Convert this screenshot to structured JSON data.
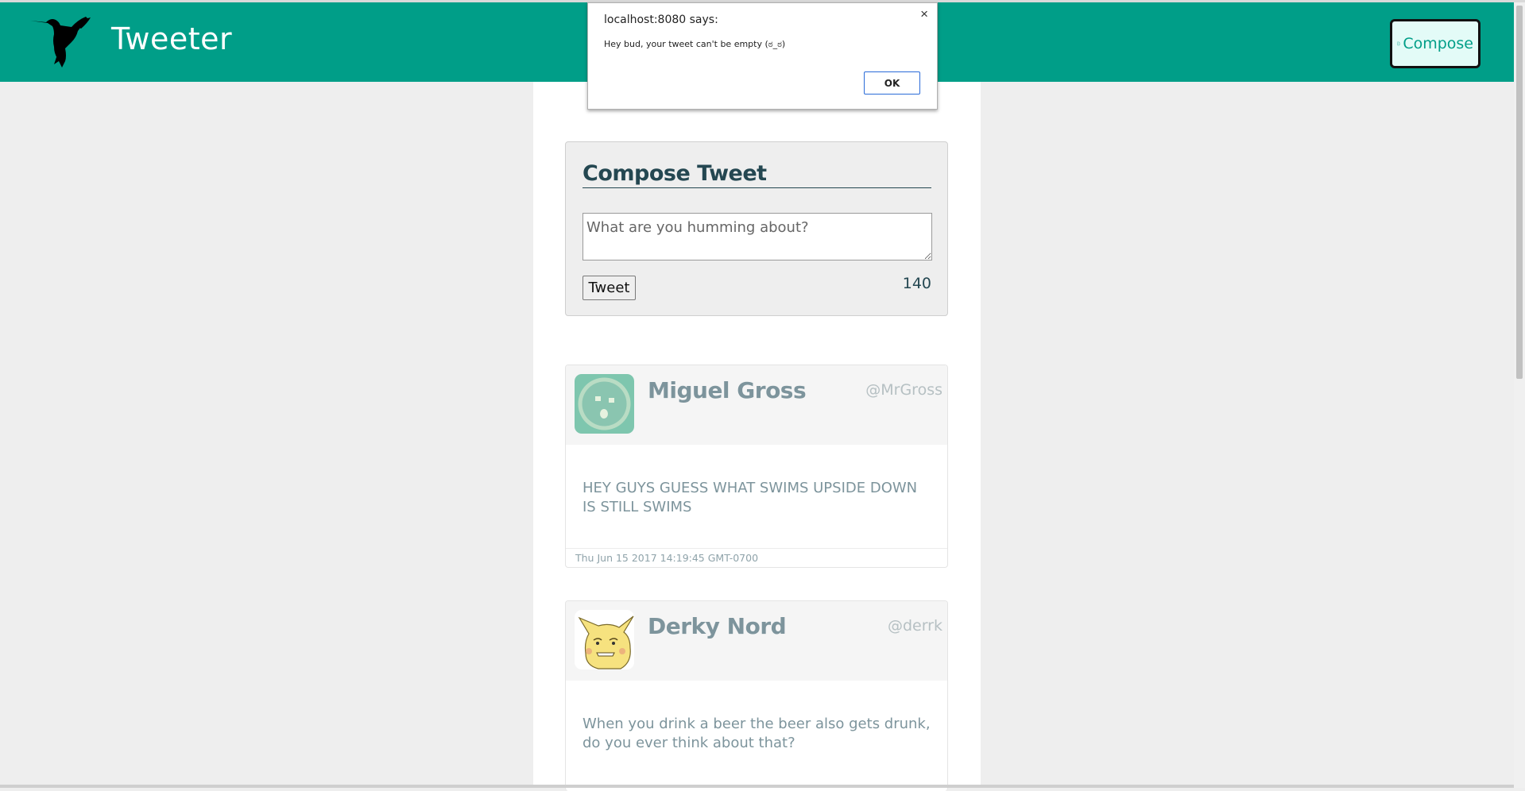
{
  "app": {
    "brand": "Tweeter",
    "compose_label": "Compose"
  },
  "compose": {
    "title": "Compose Tweet",
    "placeholder": "What are you humming about?",
    "button_label": "Tweet",
    "counter": "140"
  },
  "tweets": [
    {
      "name": "Miguel Gross",
      "handle": "@MrGross",
      "text": "HEY GUYS GUESS WHAT SWIMS UPSIDE DOWN IS STILL SWIMS",
      "timestamp": "Thu Jun 15 2017 14:19:45 GMT-0700"
    },
    {
      "name": "Derky Nord",
      "handle": "@derrk",
      "text": "When you drink a beer the beer also gets drunk, do you ever think about that?"
    }
  ],
  "alert": {
    "title": "localhost:8080 says:",
    "message": "Hey bud, your tweet can't be empty (ಠ_ಠ)",
    "ok_label": "OK",
    "close_glyph": "×"
  },
  "colors": {
    "nav": "#009e88",
    "accent_dark": "#244751",
    "text_muted": "#7d949c"
  },
  "icons": {
    "logo": "hummingbird-logo",
    "compose": "pencil-page-icon",
    "close": "close-icon"
  }
}
